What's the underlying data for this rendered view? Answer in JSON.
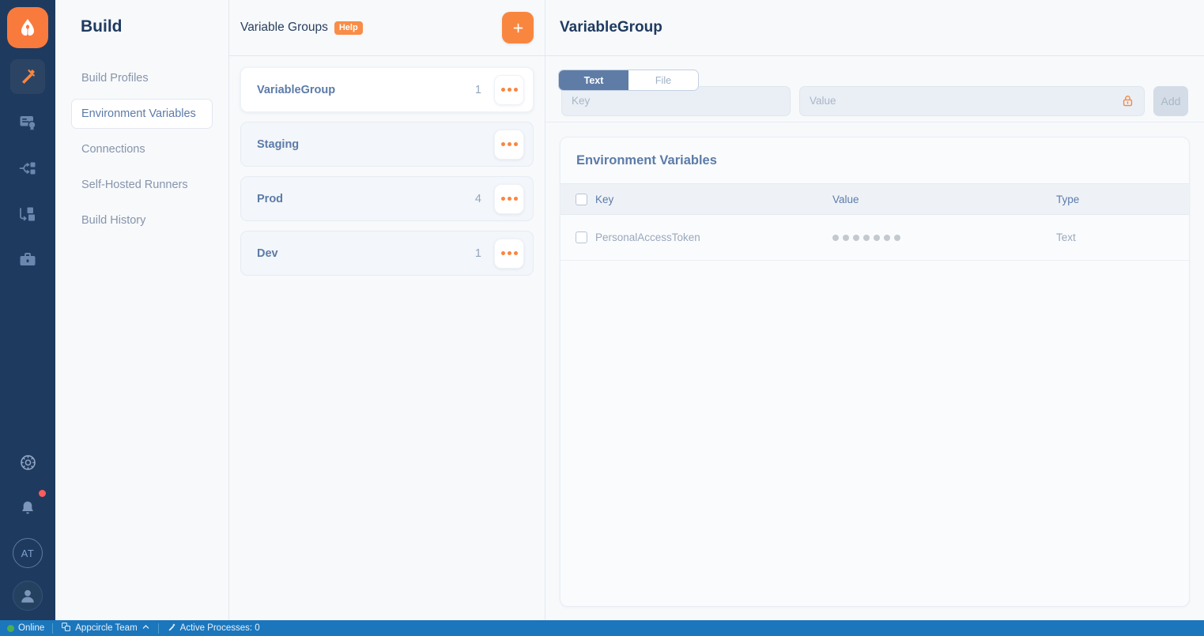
{
  "rail": {
    "logo": "appcircle-logo-icon",
    "items": [
      {
        "name": "build-icon",
        "active": true
      },
      {
        "name": "signing-identity-icon",
        "active": false
      },
      {
        "name": "distribution-icon",
        "active": false
      },
      {
        "name": "store-submit-icon",
        "active": false
      },
      {
        "name": "enterprise-store-icon",
        "active": false
      }
    ],
    "bottom": {
      "settings": "gear-icon",
      "notifications": "bell-icon",
      "org_initials": "AT",
      "profile": "user-avatar-icon"
    }
  },
  "sidebar": {
    "title": "Build",
    "items": [
      {
        "label": "Build Profiles",
        "selected": false
      },
      {
        "label": "Environment Variables",
        "selected": true
      },
      {
        "label": "Connections",
        "selected": false
      },
      {
        "label": "Self-Hosted Runners",
        "selected": false
      },
      {
        "label": "Build History",
        "selected": false
      }
    ]
  },
  "groups_panel": {
    "title": "Variable Groups",
    "help_label": "Help",
    "add_button": "+",
    "kebab_label": "•••",
    "groups": [
      {
        "name": "VariableGroup",
        "count": "1",
        "selected": true
      },
      {
        "name": "Staging",
        "count": "",
        "selected": false
      },
      {
        "name": "Prod",
        "count": "4",
        "selected": false
      },
      {
        "name": "Dev",
        "count": "1",
        "selected": false
      }
    ]
  },
  "detail": {
    "title": "VariableGroup",
    "tabs": [
      {
        "label": "Text",
        "active": true
      },
      {
        "label": "File",
        "active": false
      }
    ],
    "key_placeholder": "Key",
    "key_value": "",
    "value_placeholder": "Value",
    "value_value": "",
    "lock_icon": "lock-icon",
    "add_label": "Add",
    "table": {
      "title": "Environment Variables",
      "columns": [
        "Key",
        "Value",
        "Type"
      ],
      "rows": [
        {
          "key": "PersonalAccessToken",
          "value_masked_dots": 7,
          "type": "Text"
        }
      ]
    }
  },
  "statusbar": {
    "connection": "Online",
    "org_icon": "organization-icon",
    "org": "Appcircle Team",
    "chevron": "chevron-up-icon",
    "processes_icon": "build-icon",
    "processes": "Active Processes: 0"
  },
  "colors": {
    "accent_orange": "#f9863f",
    "navy": "#1f3a5f",
    "slate_blue": "#5c7ba8",
    "status_blue": "#1b76bc",
    "online_green": "#4caf50"
  }
}
